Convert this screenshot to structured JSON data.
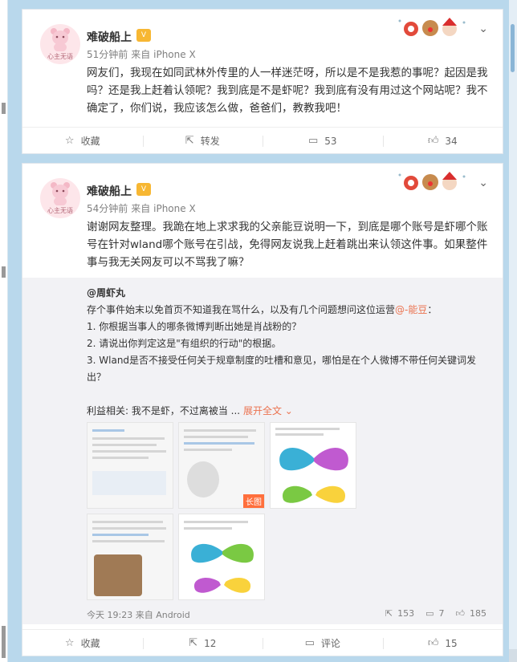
{
  "posts": [
    {
      "username": "难破船上",
      "avatar_caption": "心主无语",
      "time": "51分钟前",
      "source_prefix": "来自",
      "source": "iPhone X",
      "text": "网友们，我现在如同武林外传里的人一样迷茫呀，所以是不是我惹的事呢？起因是我吗？还是我上赶着认领呢？我到底是不是虾呢？我到底有没有用过这个网站呢？我不确定了，你们说，我应该怎么做，爸爸们，教教我吧！",
      "actions": {
        "collect": "收藏",
        "repost": "转发",
        "comments": "53",
        "likes": "34"
      }
    },
    {
      "username": "难破船上",
      "avatar_caption": "心主无语",
      "time": "54分钟前",
      "source_prefix": "来自",
      "source": "iPhone X",
      "text": "谢谢网友整理。我跪在地上求求我的父亲能豆说明一下，到底是哪个账号是虾哪个账号在针对wland哪个账号在引战，免得网友说我上赶着跳出来认领这件事。如果整件事与我无关网友可以不骂我了嘛？",
      "repost": {
        "user": "@周虾丸",
        "line1_pre": "存个事件始末以免首页不知道我在骂什么，以及有几个问题想问这位运营",
        "line1_mention": "@-能豆",
        "line1_post": "：",
        "line2": "1. 你根据当事人的哪条微博判断出她是肖战粉的？",
        "line3": "2. 请说出你判定这是\"有组织的行动\"的根据。",
        "line4": "3. Wland是否不接受任何关于规章制度的吐槽和意见，哪怕是在个人微博不带任何关键词发出？",
        "line5": "利益相关: 我不是虾，不过离被当 ...",
        "expand": "展开全文",
        "long_tag": "长图",
        "time": "今天 19:23",
        "source_prefix": "来自",
        "source": "Android",
        "reposts": "153",
        "comments": "7",
        "likes": "185"
      },
      "actions": {
        "collect": "收藏",
        "repost": "12",
        "comments": "评论",
        "likes": "15"
      }
    }
  ],
  "icons": {
    "collect": "star-icon",
    "repost": "repost-icon",
    "comment": "comment-icon",
    "like": "thumb-up-icon"
  },
  "colors": {
    "accent": "#eb7350",
    "background": "#b9d8ec"
  }
}
